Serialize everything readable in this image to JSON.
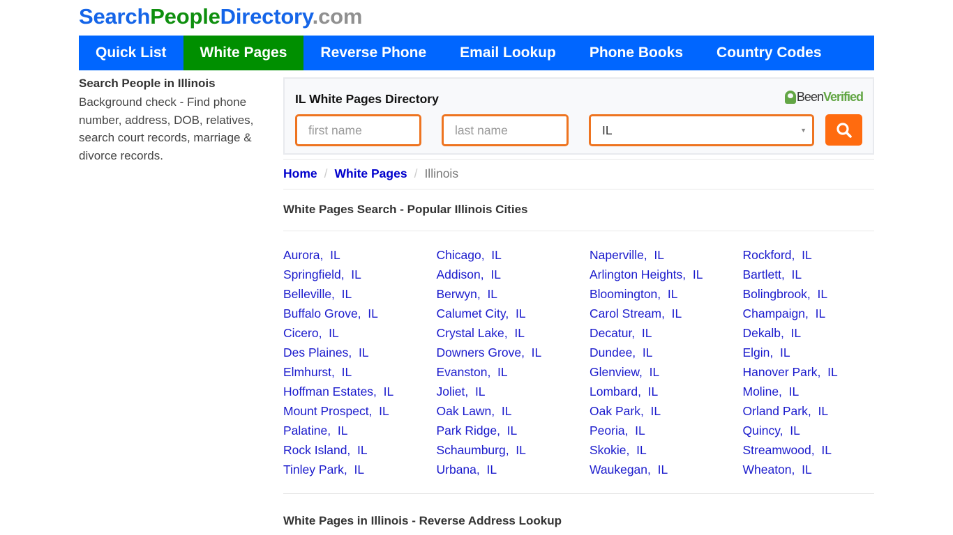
{
  "logo": {
    "part1": "Search",
    "part2": "People",
    "part3": "Directory",
    "part4": ".com"
  },
  "nav": {
    "items": [
      {
        "label": "Quick List",
        "active": false
      },
      {
        "label": "White Pages",
        "active": true
      },
      {
        "label": "Reverse Phone",
        "active": false
      },
      {
        "label": "Email Lookup",
        "active": false
      },
      {
        "label": "Phone Books",
        "active": false
      },
      {
        "label": "Country Codes",
        "active": false
      }
    ],
    "colors": {
      "bar": "#0066ff",
      "active": "#008f00"
    }
  },
  "sidebar": {
    "heading": "Search People in Illinois",
    "text": "Background check - Find phone number, address, DOB, relatives, search court records, marriage & divorce records."
  },
  "search": {
    "title": "IL White Pages Directory",
    "partner_logo": {
      "been": "Been",
      "verified": "Verified",
      "icon": "beenverified-logo-icon"
    },
    "first_name": {
      "value": "",
      "placeholder": "first name"
    },
    "last_name": {
      "value": "",
      "placeholder": "last name"
    },
    "state": {
      "selected": "IL"
    },
    "button_icon": "search-icon",
    "accent": "#ee7420"
  },
  "breadcrumb": {
    "home": "Home",
    "white_pages": "White Pages",
    "separator": "/",
    "current": "Illinois"
  },
  "sections": {
    "popular_cities_title": "White Pages Search - Popular Illinois Cities",
    "reverse_address_title": "White Pages in Illinois - Reverse Address Lookup"
  },
  "cities": [
    "Aurora,  IL",
    "Chicago,  IL",
    "Naperville,  IL",
    "Rockford,  IL",
    "Springfield,  IL",
    "Addison,  IL",
    "Arlington Heights,  IL",
    "Bartlett,  IL",
    "Belleville,  IL",
    "Berwyn,  IL",
    "Bloomington,  IL",
    "Bolingbrook,  IL",
    "Buffalo Grove,  IL",
    "Calumet City,  IL",
    "Carol Stream,  IL",
    "Champaign,  IL",
    "Cicero,  IL",
    "Crystal Lake,  IL",
    "Decatur,  IL",
    "Dekalb,  IL",
    "Des Plaines,  IL",
    "Downers Grove,  IL",
    "Dundee,  IL",
    "Elgin,  IL",
    "Elmhurst,  IL",
    "Evanston,  IL",
    "Glenview,  IL",
    "Hanover Park,  IL",
    "Hoffman Estates,  IL",
    "Joliet,  IL",
    "Lombard,  IL",
    "Moline,  IL",
    "Mount Prospect,  IL",
    "Oak Lawn,  IL",
    "Oak Park,  IL",
    "Orland Park,  IL",
    "Palatine,  IL",
    "Park Ridge,  IL",
    "Peoria,  IL",
    "Quincy,  IL",
    "Rock Island,  IL",
    "Schaumburg,  IL",
    "Skokie,  IL",
    "Streamwood,  IL",
    "Tinley Park,  IL",
    "Urbana,  IL",
    "Waukegan,  IL",
    "Wheaton,  IL"
  ]
}
